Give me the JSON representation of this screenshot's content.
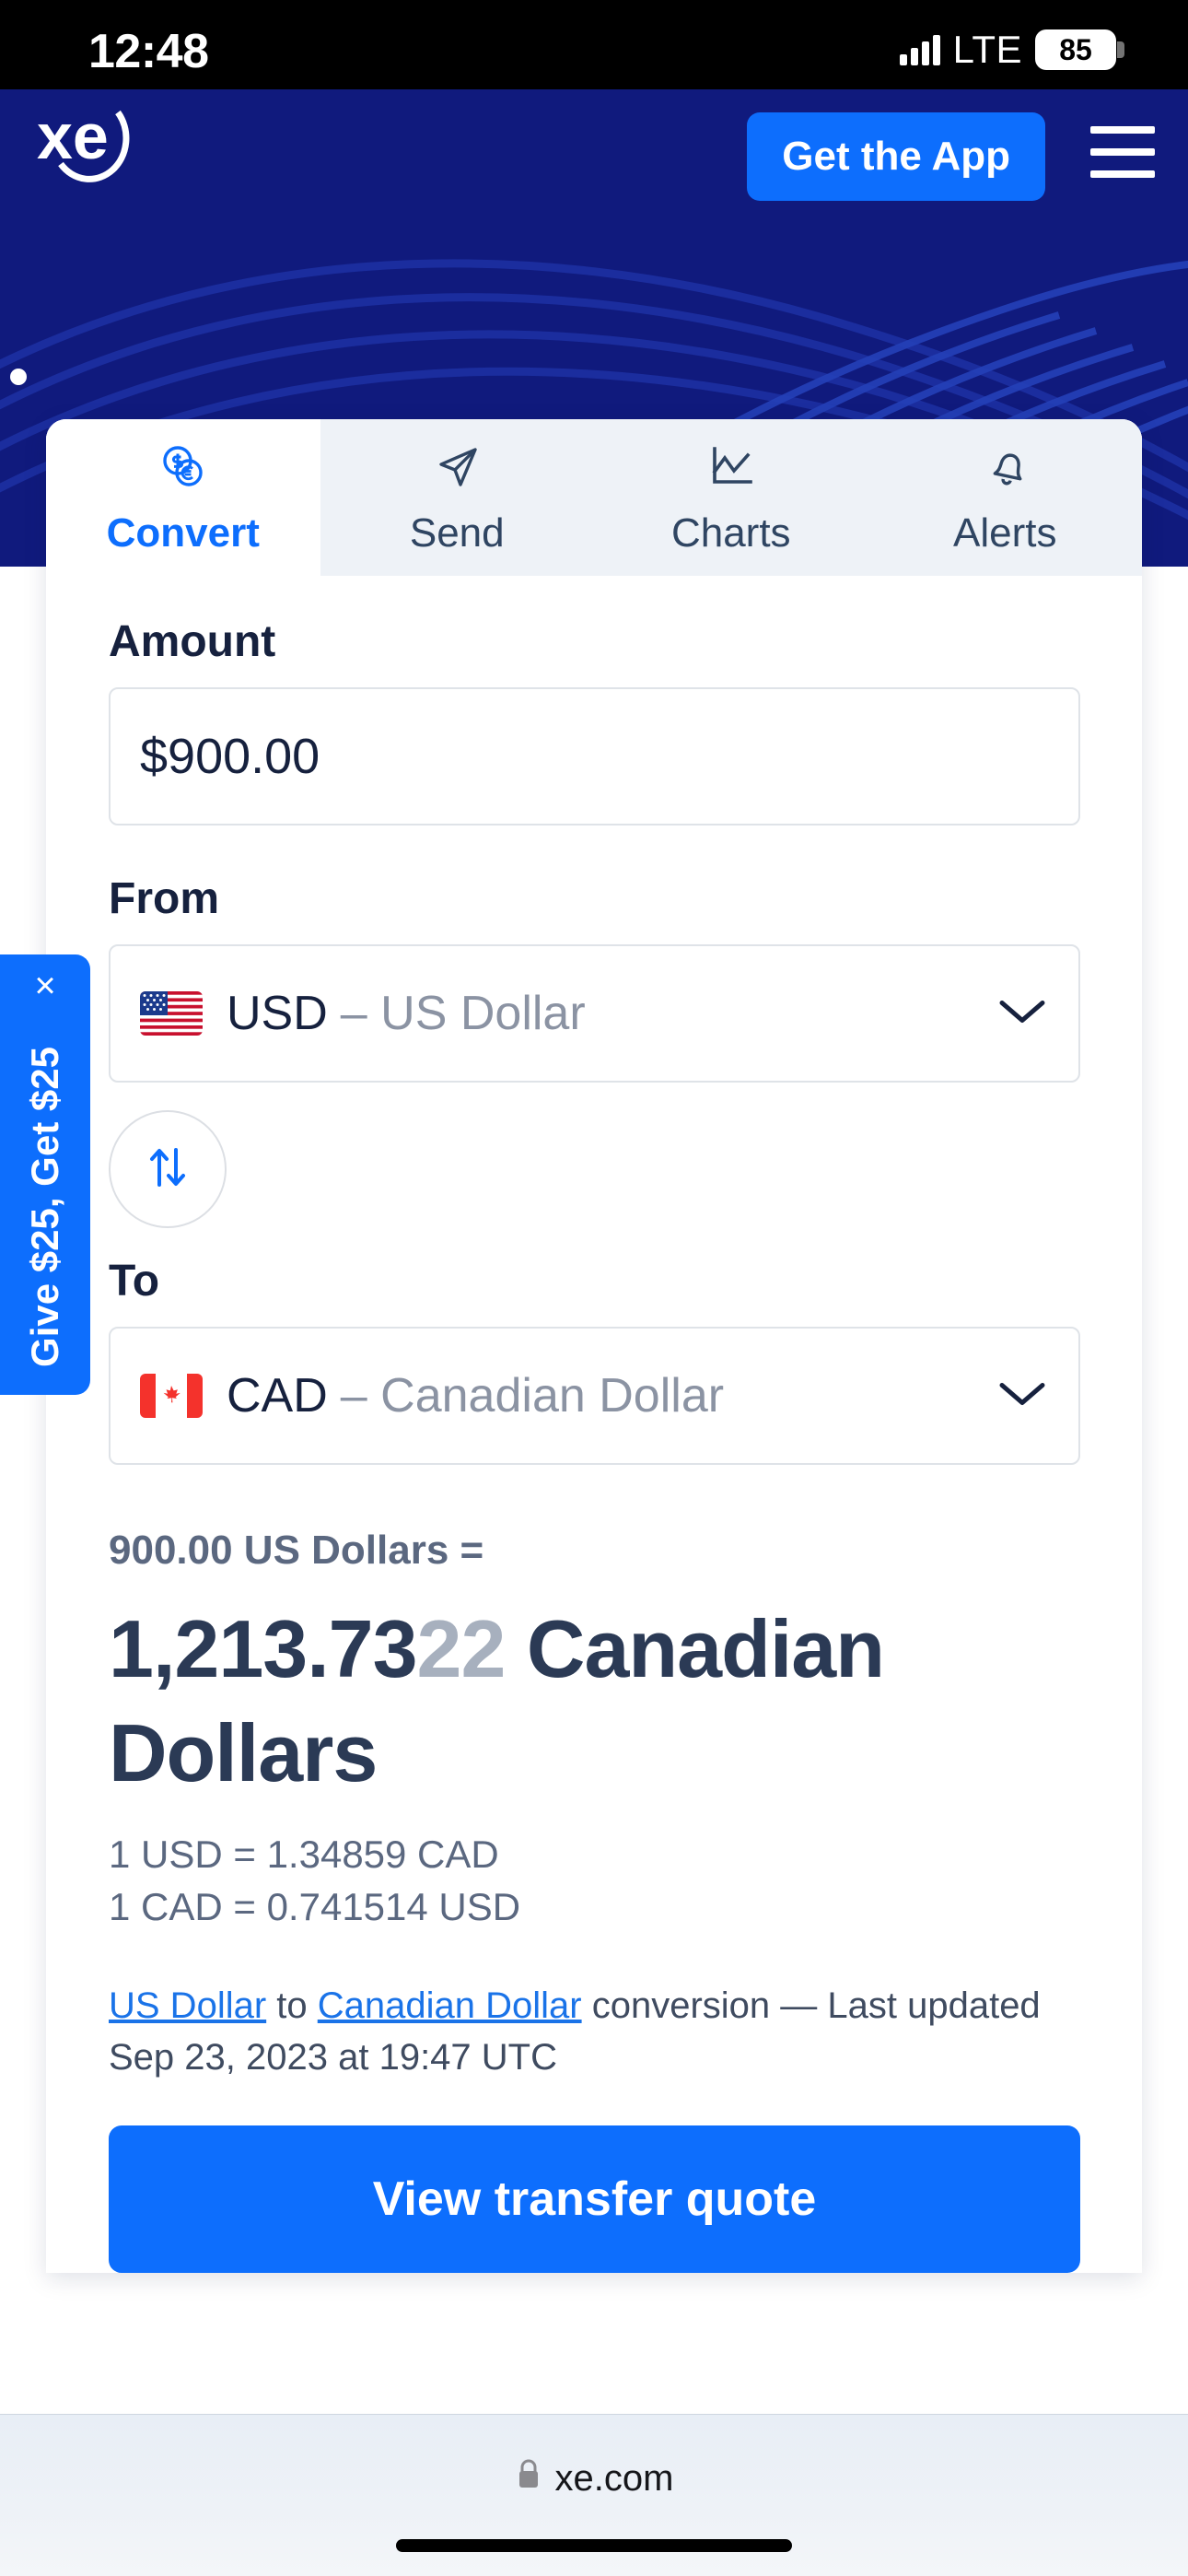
{
  "status_bar": {
    "time": "12:48",
    "network": "LTE",
    "battery_percent": "85"
  },
  "site_header": {
    "logo_text": "xe",
    "get_app_label": "Get the App",
    "menu_icon": "hamburger-menu-icon",
    "background_color": "#101a7d"
  },
  "referral_tab": {
    "label": "Give $25, Get $25",
    "close_label": "×",
    "color": "#0d6efd"
  },
  "converter": {
    "tabs": [
      {
        "label": "Convert",
        "icon": "coins-exchange-icon",
        "active": true
      },
      {
        "label": "Send",
        "icon": "paper-plane-icon",
        "active": false
      },
      {
        "label": "Charts",
        "icon": "line-chart-icon",
        "active": false
      },
      {
        "label": "Alerts",
        "icon": "bell-icon",
        "active": false
      }
    ],
    "amount": {
      "label": "Amount",
      "value": "$900.00",
      "placeholder": "$900.00"
    },
    "from": {
      "label": "From",
      "code": "USD",
      "name": "– US Dollar",
      "flag": "us-flag-icon"
    },
    "to": {
      "label": "To",
      "code": "CAD",
      "name": "– Canadian Dollar",
      "flag": "ca-flag-icon"
    },
    "swap_icon": "swap-arrows-icon",
    "result": {
      "equation": "900.00 US Dollars =",
      "amount_main": "1,213.73",
      "amount_faint": "22",
      "currency": " Canadian Dollars"
    },
    "rates": [
      "1 USD = 1.34859 CAD",
      "1 CAD = 0.741514 USD"
    ],
    "note": {
      "link_from": "US Dollar",
      "mid": " to ",
      "link_to": "Canadian Dollar",
      "tail": " conversion — Last updated Sep 23, 2023 at 19:47 UTC"
    },
    "cta_label": "View transfer quote"
  },
  "browser_bar": {
    "url": "xe.com",
    "lock_icon": "lock-icon"
  }
}
